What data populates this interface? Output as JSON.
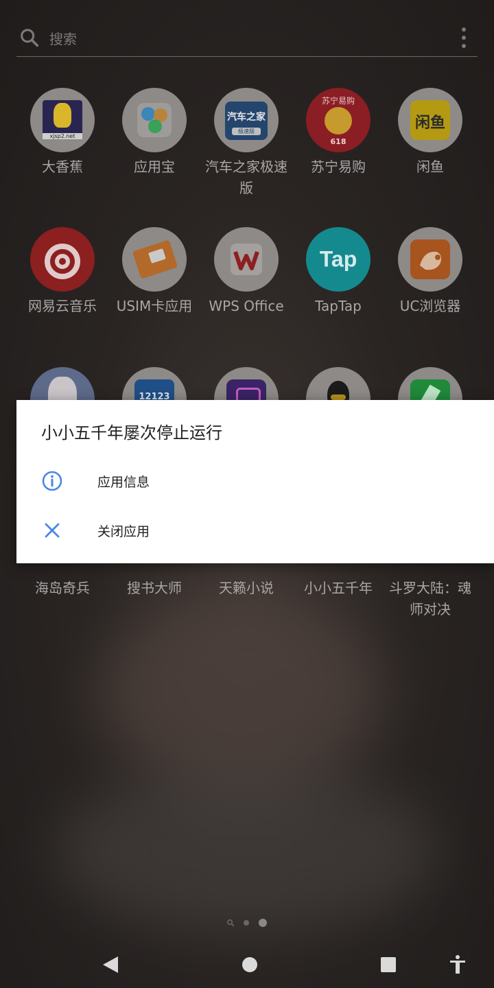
{
  "search": {
    "placeholder": "搜索"
  },
  "apps_row1": [
    {
      "label": "大香蕉",
      "icon": "banana-app-icon"
    },
    {
      "label": "应用宝",
      "icon": "appstore-icon"
    },
    {
      "label": "汽车之家极速版",
      "icon": "autohome-icon"
    },
    {
      "label": "苏宁易购",
      "icon": "suning-icon"
    },
    {
      "label": "闲鱼",
      "icon": "xianyu-icon"
    }
  ],
  "apps_row2": [
    {
      "label": "网易云音乐",
      "icon": "netease-music-icon"
    },
    {
      "label": "USIM卡应用",
      "icon": "sim-card-icon"
    },
    {
      "label": "WPS Office",
      "icon": "wps-icon"
    },
    {
      "label": "TapTap",
      "icon": "taptap-icon"
    },
    {
      "label": "UC浏览器",
      "icon": "uc-browser-icon"
    }
  ],
  "apps_row3": [
    {
      "label": "海岛奇兵",
      "icon": "game-icon"
    },
    {
      "label": "搜书大师",
      "icon": "book-icon"
    },
    {
      "label": "天籁小说",
      "icon": "novel-icon"
    },
    {
      "label": "小小五千年",
      "icon": "qq-penguin-icon"
    },
    {
      "label": "斗罗大陆：魂师对决",
      "icon": "game-icon"
    }
  ],
  "app_icon_text": {
    "banana_caption": "xjsp2.net",
    "autohome_line1": "汽车之家",
    "autohome_line2": "极速版",
    "suning_top": "苏宁易购",
    "suning_bottom": "618",
    "xianyu": "闲鱼",
    "taptap": "Tap",
    "row3_2": "12123"
  },
  "dialog": {
    "title": "小小五千年屡次停止运行",
    "options": [
      {
        "label": "应用信息",
        "icon": "info-icon"
      },
      {
        "label": "关闭应用",
        "icon": "close-icon"
      }
    ]
  },
  "colors": {
    "dialog_bg": "#ffffff",
    "accent": "#4a86e8",
    "scrim": "#2a2523"
  }
}
